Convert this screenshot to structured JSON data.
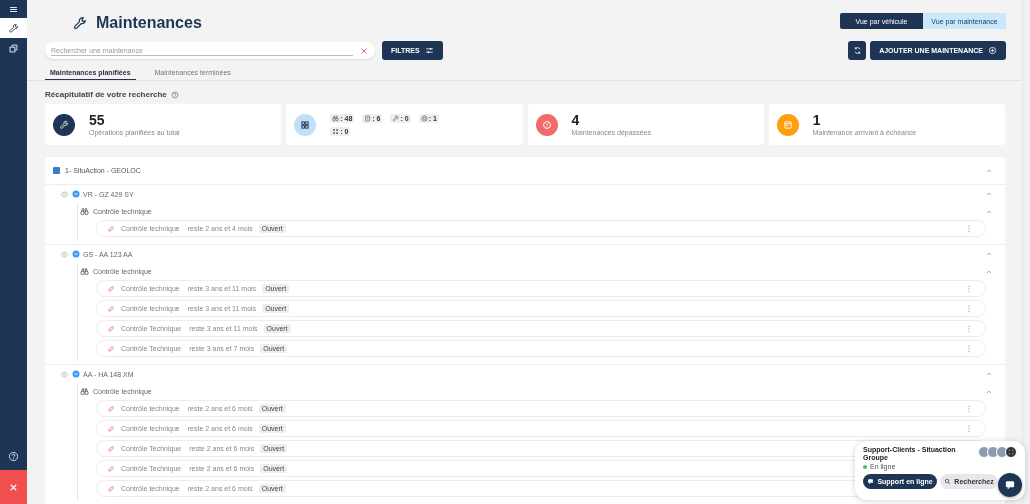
{
  "sidebar": {
    "items": [
      {
        "kind": "menu",
        "selected": false
      },
      {
        "kind": "wrench",
        "selected": true
      },
      {
        "kind": "copy",
        "selected": false
      }
    ],
    "bottom": [
      {
        "kind": "help"
      },
      {
        "kind": "close"
      }
    ]
  },
  "header": {
    "title": "Maintenances",
    "views": [
      {
        "label": "Vue par véhicule",
        "selected": true
      },
      {
        "label": "Vue par maintenance",
        "selected": false
      }
    ],
    "search": {
      "placeholder": "Rechercher une maintenance"
    },
    "filter_button": "FILTRES",
    "add_button": "AJOUTER UNE MAINTENANCE"
  },
  "tabs": [
    {
      "label": "Maintenances planifiées",
      "selected": true
    },
    {
      "label": "Maintenances terminées",
      "selected": false
    }
  ],
  "recap": {
    "title": "Récapitulatif de votre recherche",
    "cards": [
      {
        "kind": "wrench",
        "color": "#1f3556",
        "value": "55",
        "label": "Opérations planifiées au total"
      },
      {
        "kind": "chips",
        "color": "#bfe0f8",
        "chips": [
          {
            "kind": "binoculars",
            "text": ": 48"
          },
          {
            "kind": "document",
            "text": ": 6"
          },
          {
            "kind": "wrench",
            "text": ": 0"
          },
          {
            "kind": "tire",
            "text": ": 1"
          },
          {
            "kind": "grid",
            "text": ": 0"
          }
        ]
      },
      {
        "kind": "alert",
        "color": "#f26b6b",
        "value": "4",
        "label": "Maintenances dépassées"
      },
      {
        "kind": "calendar",
        "color": "#ff9f0f",
        "value": "1",
        "label": "Maintenance arrivant à échéance"
      }
    ]
  },
  "group": {
    "title": "1- SituAction - GEOLOC",
    "expanded": true,
    "vehicles": [
      {
        "name": "VR - GZ 429 SY",
        "expanded": true,
        "categories": [
          {
            "name": "Contrôle technique",
            "expanded": true,
            "items": [
              {
                "name": "Contrôle technique",
                "remaining": "reste 2 ans et 4 mois",
                "status": "Ouvert"
              }
            ]
          }
        ]
      },
      {
        "name": "GS - AA 123 AA",
        "expanded": true,
        "categories": [
          {
            "name": "Contrôle technique",
            "expanded": true,
            "items": [
              {
                "name": "Contrôle technique",
                "remaining": "reste 3 ans et 11 mois",
                "status": "Ouvert"
              },
              {
                "name": "Contrôle technique",
                "remaining": "reste 3 ans et 11 mois",
                "status": "Ouvert"
              },
              {
                "name": "Contrôle Technique",
                "remaining": "reste 3 ans et 11 mois",
                "status": "Ouvert"
              },
              {
                "name": "Contrôle Technique",
                "remaining": "reste 3 ans et 7 mois",
                "status": "Ouvert"
              }
            ]
          }
        ]
      },
      {
        "name": "AA - HA 148 XM",
        "expanded": true,
        "categories": [
          {
            "name": "Contrôle technique",
            "expanded": true,
            "items": [
              {
                "name": "Contrôle technique",
                "remaining": "reste 2 ans et 6 mois",
                "status": "Ouvert"
              },
              {
                "name": "Contrôle technique",
                "remaining": "reste 2 ans et 6 mois",
                "status": "Ouvert"
              },
              {
                "name": "Contrôle Technique",
                "remaining": "reste 2 ans et 6 mois",
                "status": "Ouvert"
              },
              {
                "name": "Contrôle Technique",
                "remaining": "reste 2 ans et 6 mois",
                "status": "Ouvert"
              },
              {
                "name": "Contrôle technique",
                "remaining": "reste 2 ans et 6 mois",
                "status": "Ouvert"
              }
            ]
          }
        ]
      }
    ]
  },
  "chat": {
    "title": "Support-Clients - Situaction Groupe",
    "status": "En ligne",
    "online": true,
    "buttons": [
      {
        "kind": "primary",
        "label": "Support en ligne"
      },
      {
        "kind": "secondary",
        "label": "Recherchez"
      }
    ]
  }
}
